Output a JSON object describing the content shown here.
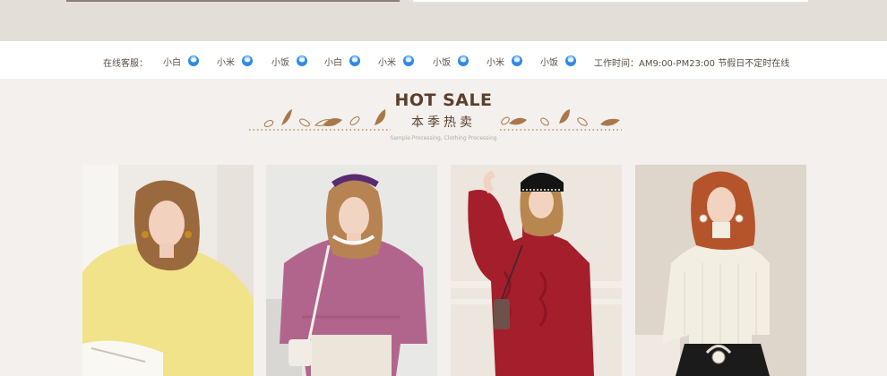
{
  "service": {
    "label": "在线客服：",
    "agents": [
      "小白",
      "小米",
      "小饭",
      "小白",
      "小米",
      "小饭",
      "小米",
      "小饭"
    ],
    "hours": "工作时间：AM9:00-PM23:00 节假日不定时在线"
  },
  "section": {
    "title": "HOT SALE",
    "subtitle_cn": "本季热卖",
    "subtitle_en": "Sample Processing, Clothing Processing"
  },
  "colors": {
    "brand_brown": "#5a3f2c",
    "leaf_brown": "#a8784a",
    "qq_blue": "#2d8ae6"
  },
  "products": [
    {
      "name": "yellow-lace-sweater",
      "icon": "photo-yellow-sweater"
    },
    {
      "name": "pink-knit-sweater",
      "icon": "photo-pink-sweater"
    },
    {
      "name": "red-cable-turtleneck",
      "icon": "photo-red-turtleneck"
    },
    {
      "name": "cream-ribbed-top",
      "icon": "photo-cream-top"
    }
  ]
}
